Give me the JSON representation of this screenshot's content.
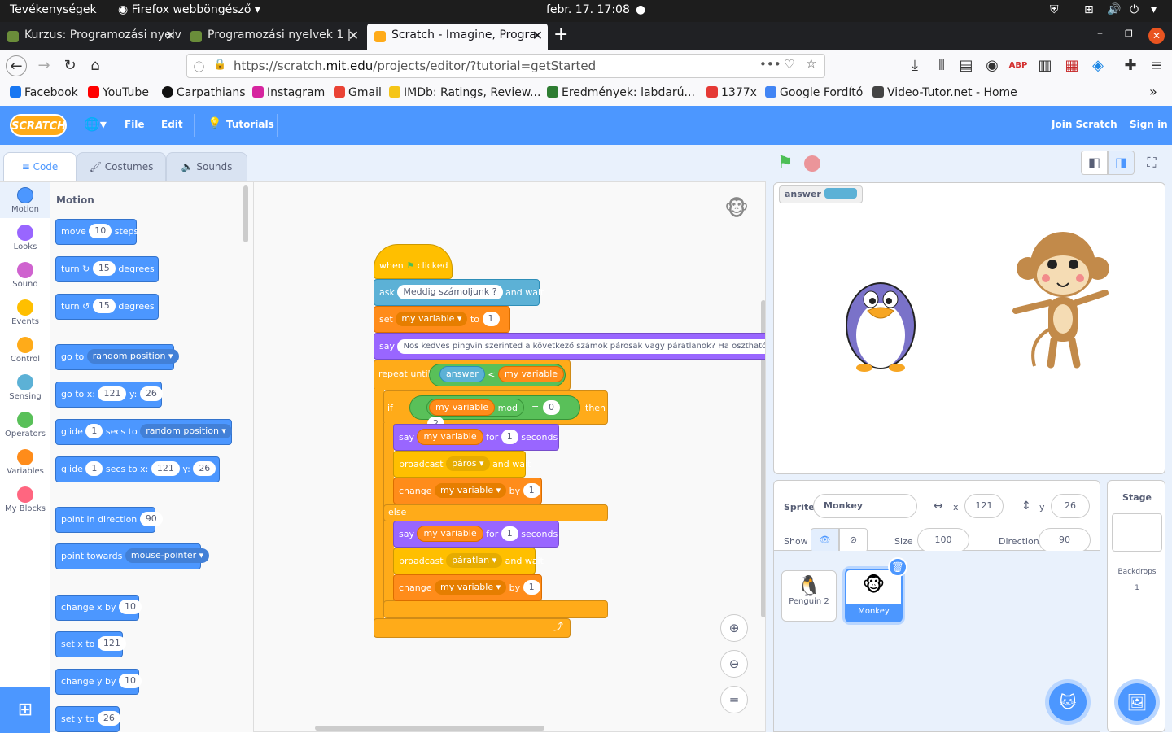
{
  "system": {
    "activities": "Tevékenységek",
    "app": "Firefox webböngésző",
    "clock": "febr. 17.  17:08"
  },
  "tabs": [
    {
      "title": "Kurzus: Programozási nyelv"
    },
    {
      "title": "Programozási nyelvek 1 |"
    },
    {
      "title": "Scratch - Imagine, Progra"
    }
  ],
  "url": {
    "prefix": "https://scratch.",
    "domain": "mit.edu",
    "path": "/projects/editor/?tutorial=getStarted"
  },
  "bookmarks": [
    {
      "label": "Facebook",
      "color": "#1877f2"
    },
    {
      "label": "YouTube",
      "color": "#ff0000"
    },
    {
      "label": "Carpathians",
      "color": "#111111"
    },
    {
      "label": "Instagram",
      "color": "#d6249f"
    },
    {
      "label": "Gmail",
      "color": "#ea4335"
    },
    {
      "label": "IMDb: Ratings, Review...",
      "color": "#f5c518"
    },
    {
      "label": "Eredmények: labdarú...",
      "color": "#2e7d32"
    },
    {
      "label": "1377x",
      "color": "#e53935"
    },
    {
      "label": "Google Fordító",
      "color": "#4285f4"
    },
    {
      "label": "Video-Tutor.net - Home",
      "color": "#444444"
    }
  ],
  "menu": {
    "logo": "SCRATCH",
    "file": "File",
    "edit": "Edit",
    "tutorials": "Tutorials",
    "join": "Join Scratch",
    "signin": "Sign in"
  },
  "editor_tabs": {
    "code": "Code",
    "costumes": "Costumes",
    "sounds": "Sounds"
  },
  "categories": [
    {
      "label": "Motion",
      "color": "#4c97ff"
    },
    {
      "label": "Looks",
      "color": "#9966ff"
    },
    {
      "label": "Sound",
      "color": "#cf63cf"
    },
    {
      "label": "Events",
      "color": "#ffbf00"
    },
    {
      "label": "Control",
      "color": "#ffab19"
    },
    {
      "label": "Sensing",
      "color": "#5cb1d6"
    },
    {
      "label": "Operators",
      "color": "#59c059"
    },
    {
      "label": "Variables",
      "color": "#ff8c1a"
    },
    {
      "label": "My Blocks",
      "color": "#ff6680"
    }
  ],
  "palette": {
    "heading": "Motion",
    "move": {
      "a": "move",
      "v": "10",
      "b": "steps"
    },
    "turn_r": {
      "a": "turn",
      "v": "15",
      "b": "degrees"
    },
    "turn_l": {
      "a": "turn",
      "v": "15",
      "b": "degrees"
    },
    "goto": {
      "a": "go to",
      "v": "random position"
    },
    "gotoxy": {
      "a": "go to x:",
      "x": "121",
      "b": "y:",
      "y": "26"
    },
    "glide": {
      "a": "glide",
      "v": "1",
      "b": "secs to",
      "t": "random position"
    },
    "glidexy": {
      "a": "glide",
      "v": "1",
      "b": "secs to x:",
      "x": "121",
      "c": "y:",
      "y": "26"
    },
    "point": {
      "a": "point in direction",
      "v": "90"
    },
    "towards": {
      "a": "point towards",
      "v": "mouse-pointer"
    },
    "changex": {
      "a": "change x by",
      "v": "10"
    },
    "setx": {
      "a": "set x to",
      "v": "121"
    },
    "changey": {
      "a": "change y by",
      "v": "10"
    },
    "sety": {
      "a": "set y to",
      "v": "26"
    }
  },
  "script": {
    "when": "when",
    "clicked": "clicked",
    "ask": "ask",
    "ask_q": "Meddig számoljunk ?",
    "and_wait": "and wait",
    "set": "set",
    "var": "my variable",
    "to": "to",
    "one": "1",
    "say": "say",
    "say_text": "Nos kedves pingvin szerinted a következő számok párosak vagy páratlanok? Ha osztható h",
    "repeat_until": "repeat until",
    "answer": "answer",
    "lt": "<",
    "if": "if",
    "mod": "mod",
    "two": "2",
    "eq": "=",
    "zero": "0",
    "then": "then",
    "for": "for",
    "seconds": "seconds",
    "broadcast": "broadcast",
    "paros": "páros",
    "paratlan": "páratlan",
    "change": "change",
    "by": "by",
    "else": "else"
  },
  "stage": {
    "monitor_label": "answer"
  },
  "sprite_info": {
    "sprite_label": "Sprite",
    "sprite_name": "Monkey",
    "x_label": "x",
    "x": "121",
    "y_label": "y",
    "y": "26",
    "show_label": "Show",
    "size_label": "Size",
    "size": "100",
    "direction_label": "Direction",
    "direction": "90"
  },
  "sprites": [
    {
      "name": "Penguin 2"
    },
    {
      "name": "Monkey"
    }
  ],
  "stage_panel": {
    "title": "Stage",
    "backdrops_label": "Backdrops",
    "backdrops_count": "1"
  }
}
